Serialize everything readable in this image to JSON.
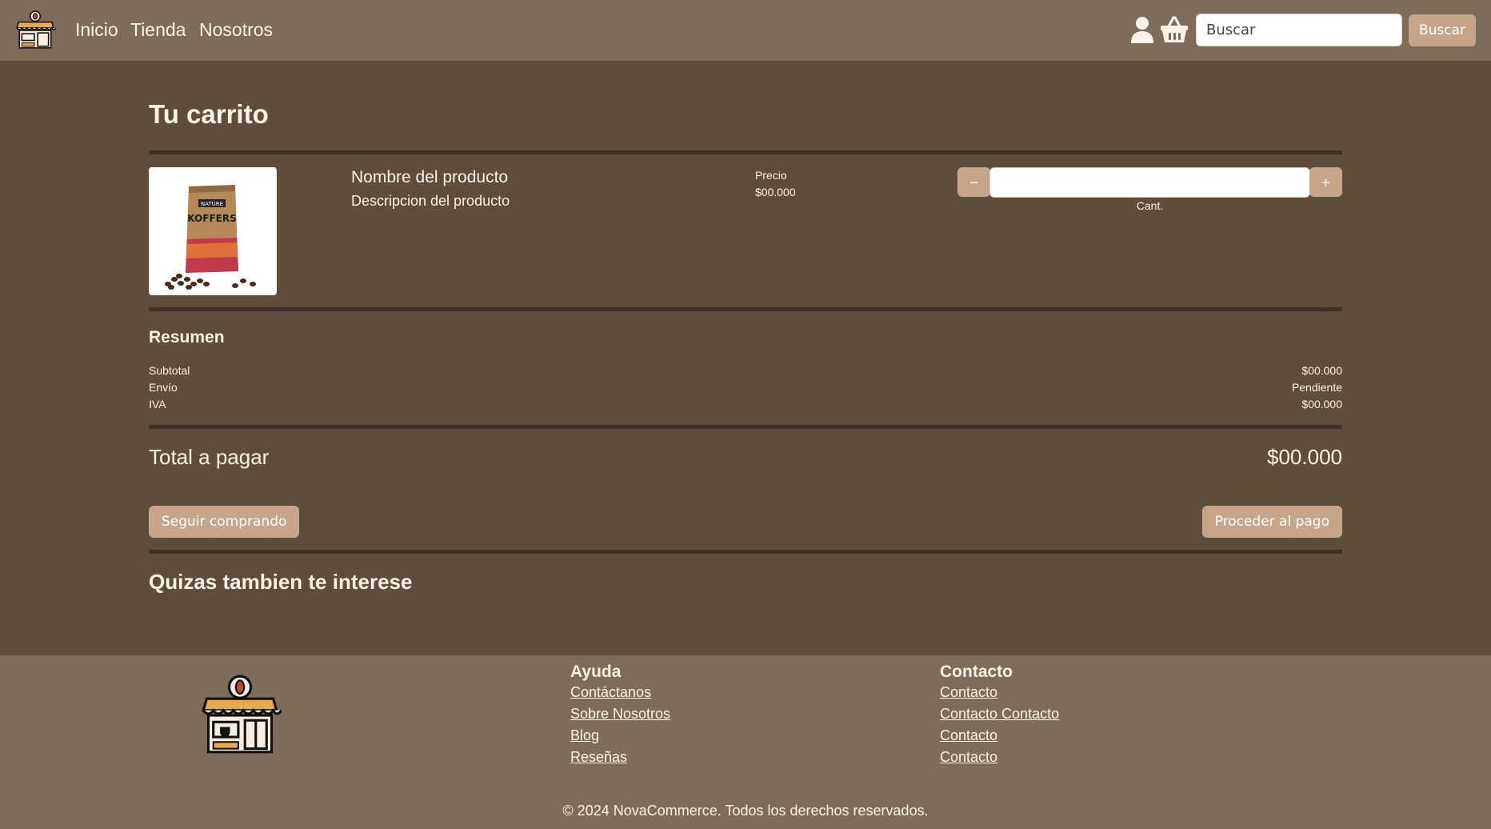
{
  "nav": {
    "links": [
      "Inicio",
      "Tienda",
      "Nosotros"
    ],
    "search": {
      "placeholder": "Buscar",
      "button_label": "Buscar"
    }
  },
  "cart": {
    "title": "Tu carrito",
    "item": {
      "name": "Nombre del producto",
      "description": "Descripcion del producto",
      "price_label": "Precio",
      "price_value": "$00.000",
      "minus_label": "−",
      "plus_label": "+",
      "qty_label": "Cant.",
      "image_text": [
        "NATURE",
        "KOFFERS"
      ]
    }
  },
  "summary": {
    "title": "Resumen",
    "rows": [
      {
        "label": "Subtotal",
        "value": "$00.000"
      },
      {
        "label": "Envío",
        "value": "Pendiente"
      },
      {
        "label": "IVA",
        "value": "$00.000"
      }
    ],
    "total_label": "Total a pagar",
    "total_value": "$00.000",
    "continue_label": "Seguir comprando",
    "checkout_label": "Proceder al pago"
  },
  "related": {
    "title": "Quizas tambien te interese"
  },
  "footer": {
    "help": {
      "title": "Ayuda",
      "links": [
        "Contáctanos",
        "Sobre Nosotros",
        "Blog",
        "Reseñas"
      ]
    },
    "contact": {
      "title": "Contacto",
      "links": [
        "Contacto",
        "Contacto Contacto",
        "Contacto",
        "Contacto"
      ]
    },
    "copyright": "© 2024 NovaCommerce. Todos los derechos reservados."
  },
  "icons": {
    "logo": "coffee-shop-logo-icon",
    "user": "user-icon",
    "cart": "basket-icon"
  },
  "colors": {
    "navbar": "#7d6c5a",
    "background": "#5e4c3d",
    "accent_button": "#c7a58a",
    "text": "#fbf3e6"
  }
}
